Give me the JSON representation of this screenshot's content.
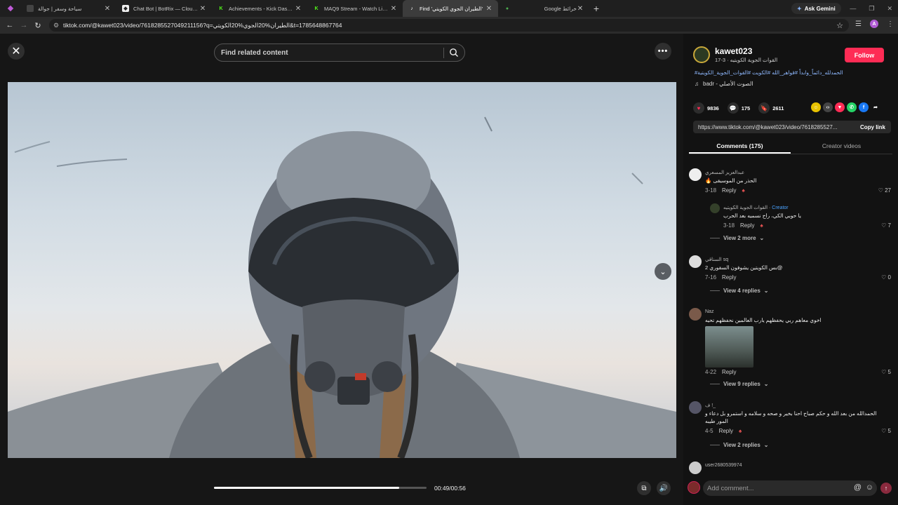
{
  "browser": {
    "tabs": [
      {
        "title": "سياحة وسفر | جوالة",
        "active": false
      },
      {
        "title": "Chat Bot | BotRix — Cloud Stre",
        "active": false
      },
      {
        "title": "Achievements - Kick Dashboard",
        "active": false
      },
      {
        "title": "MAQ9 Stream - Watch Live on",
        "active": false
      },
      {
        "title": "Find 'الطيران الجوي الكويتي'",
        "active": true
      },
      {
        "title": "Google خرائط",
        "active": false
      }
    ],
    "new_tab_label": "+",
    "gemini_label": "Ask Gemini",
    "profile_initial": "A",
    "url": "tiktok.com/@kawet023/video/7618285527049211156?q=الطيران%20الجوي%20الكويتي&t=1785648867764"
  },
  "search": {
    "placeholder": "Find related content"
  },
  "player": {
    "progress_fraction": 0.87,
    "time_label": "00:49/00:56"
  },
  "author": {
    "username": "kawet023",
    "nickname": "القوات الجوية الكويتيه · 3-17",
    "follow_label": "Follow",
    "hashtags": "#الحمدلله_دائماً_وابداً #قواهر_الله #الكويت #القوات_الجوية_الكويتية",
    "music": "badr - الصوت الأصلي"
  },
  "actions": {
    "likes": "9836",
    "comments": "175",
    "saves": "2611"
  },
  "share_link": {
    "url": "https://www.tiktok.com/@kawet023/video/7618285527...",
    "copy_label": "Copy link"
  },
  "panel_tabs": {
    "comments": "Comments (175)",
    "creator_videos": "Creator videos"
  },
  "comments": [
    {
      "name": "عبدالعزيز المسعري",
      "text": "الحذر من الموسيقى",
      "date": "3-18",
      "reply": "Reply",
      "likes": "27"
    },
    {
      "name": "القوات الجوية الكويتيه",
      "badge": "Creator",
      "text": "يا حوبي الكي، راح نسميه بعد الحرب",
      "date": "3-18",
      "reply": "Reply",
      "likes": "7"
    },
    {
      "view_more": "View 2 more"
    },
    {
      "name": "السناقي sq",
      "text": "بس الكويتين يشوفون السقوري 2@",
      "date": "7-16",
      "reply": "Reply",
      "likes": "0"
    },
    {
      "view_more": "View 4 replies"
    },
    {
      "name": "Naz",
      "text": "اخوي معاهم ربي يحفظهم يارب العالمين نحفظهم تحيه",
      "date": "4-22",
      "reply": "Reply",
      "likes": "5"
    },
    {
      "view_more": "View 9 replies"
    },
    {
      "name": "ف !_",
      "text": "الحمدالله من بعد الله و حكم صباح احنا بخير و صحه و سلامه و استمرو بل دعاء و",
      "text2": "المور طيبه",
      "date": "4-5",
      "reply": "Reply",
      "likes": "5"
    },
    {
      "view_more": "View 2 replies"
    },
    {
      "name": "user2680539974"
    }
  ],
  "add_comment": {
    "placeholder": "Add comment..."
  },
  "colors": {
    "accent": "#fe2c55",
    "link": "#8fb9ff",
    "creator": "#4aa3ff"
  }
}
